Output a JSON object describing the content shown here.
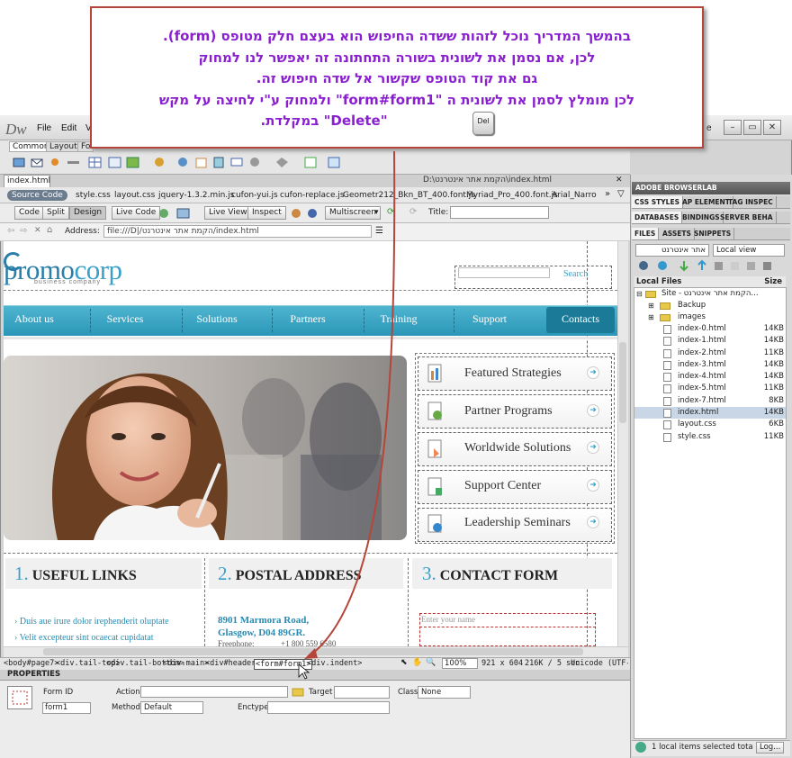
{
  "annotation": {
    "lines": [
      "בהמשך המדריך נוכל לזהות ששדה החיפוש הוא בעצם חלק מטופס (form).",
      "לכן, אם נסמן את לשונית בשורה התחתונה זה יאפשר לנו למחוק",
      "גם את קוד הטופס שקשור אל שדה חיפוש זה.",
      "לכן מומלץ לסמן את לשונית ה \"form#form1\" ולמחוק ע\"י לחיצה על מקש",
      "\"Delete\" במקלדת."
    ],
    "key_label": "Del"
  },
  "app": {
    "logo": "Dw",
    "menus": [
      "File",
      "Edit",
      "V"
    ],
    "window_controls": [
      "–",
      "▭",
      "✕"
    ],
    "right_menu_fragment": "e",
    "insert_tabs": [
      "Common",
      "Layout",
      "Fo"
    ]
  },
  "document": {
    "tab_name": "index.html",
    "path": "D:\\הקמת אתר אינטרנט\\index.html",
    "source_code_label": "Source Code",
    "related_files": [
      "style.css",
      "layout.css",
      "jquery-1.3.2.min.js",
      "cufon-yui.js",
      "cufon-replace.js",
      "Geometr212_Bkn_BT_400.font.js",
      "Myriad_Pro_400.font.js",
      "Arial_Narro"
    ],
    "view_buttons": {
      "code": "Code",
      "split": "Split",
      "design": "Design",
      "live_code": "Live Code",
      "live_view": "Live View",
      "inspect": "Inspect",
      "multiscreen": "Multiscreen",
      "title_label": "Title:"
    },
    "address_label": "Address:",
    "address_value": "file:///D|/הקמת אתר אינטרנט/index.html"
  },
  "site": {
    "logo_promo": "promo",
    "logo_corp": "corp",
    "tagline": "business company",
    "search_button": "Search",
    "nav": [
      "About us",
      "Services",
      "Solutions",
      "Partners",
      "Training",
      "Support",
      "Contacts"
    ],
    "features": [
      "Featured Strategies",
      "Partner Programs",
      "Worldwide Solutions",
      "Support Center",
      "Leadership Seminars"
    ],
    "columns": [
      {
        "num": "1.",
        "title": "USEFUL LINKS"
      },
      {
        "num": "2.",
        "title": "POSTAL ADDRESS"
      },
      {
        "num": "3.",
        "title": "CONTACT FORM"
      }
    ],
    "links": [
      "Duis aue irure dolor irephenderit oluptate",
      "Velit excepteur sint ocaecat cupidatat"
    ],
    "address_lines": [
      "8901 Marmora Road,",
      "Glasgow, D04 89GR."
    ],
    "phone_label": "Freephone:",
    "phone_value": "+1 800 559 6580",
    "contact_placeholder": "Enter your name"
  },
  "statusbar": {
    "tags": [
      "<body#page7>",
      "<div.tail-top>",
      "<div.tail-bottom>",
      "<div.main>",
      "<div#header>",
      "<form#form1>",
      "<div.indent>"
    ],
    "zoom": "100%",
    "dimensions": "921 x 604",
    "size_time": "216K / 5 sec",
    "encoding": "Unicode (UTF-8"
  },
  "properties": {
    "title": "PROPERTIES",
    "form_id_label": "Form ID",
    "form_id_value": "form1",
    "action_label": "Action",
    "target_label": "Target",
    "class_label": "Class",
    "class_value": "None",
    "method_label": "Method",
    "method_value": "Default",
    "enctype_label": "Enctype"
  },
  "panel": {
    "browserlab": "ADOBE BROWSERLAB",
    "css_tabs": [
      "CSS STYLES",
      "AP ELEMENT",
      "TAG INSPEC"
    ],
    "db_tabs": [
      "DATABASES",
      "BINDINGS",
      "SERVER BEHA"
    ],
    "file_tabs": [
      "FILES",
      "ASSETS",
      "SNIPPETS"
    ],
    "site_select": "אתר אינטרנט",
    "view_select": "Local view",
    "col_local": "Local Files",
    "col_size": "Size",
    "site_root": "Site - הקמת אתר אינטרנט...",
    "folders": [
      "Backup",
      "images"
    ],
    "files": [
      {
        "name": "index-0.html",
        "size": "14KB"
      },
      {
        "name": "index-1.html",
        "size": "14KB"
      },
      {
        "name": "index-2.html",
        "size": "11KB"
      },
      {
        "name": "index-3.html",
        "size": "14KB"
      },
      {
        "name": "index-4.html",
        "size": "14KB"
      },
      {
        "name": "index-5.html",
        "size": "11KB"
      },
      {
        "name": "index-7.html",
        "size": "8KB"
      },
      {
        "name": "index.html",
        "size": "14KB"
      },
      {
        "name": "layout.css",
        "size": "6KB"
      },
      {
        "name": "style.css",
        "size": "11KB"
      }
    ],
    "status": "1 local items selected tota",
    "log_button": "Log..."
  }
}
